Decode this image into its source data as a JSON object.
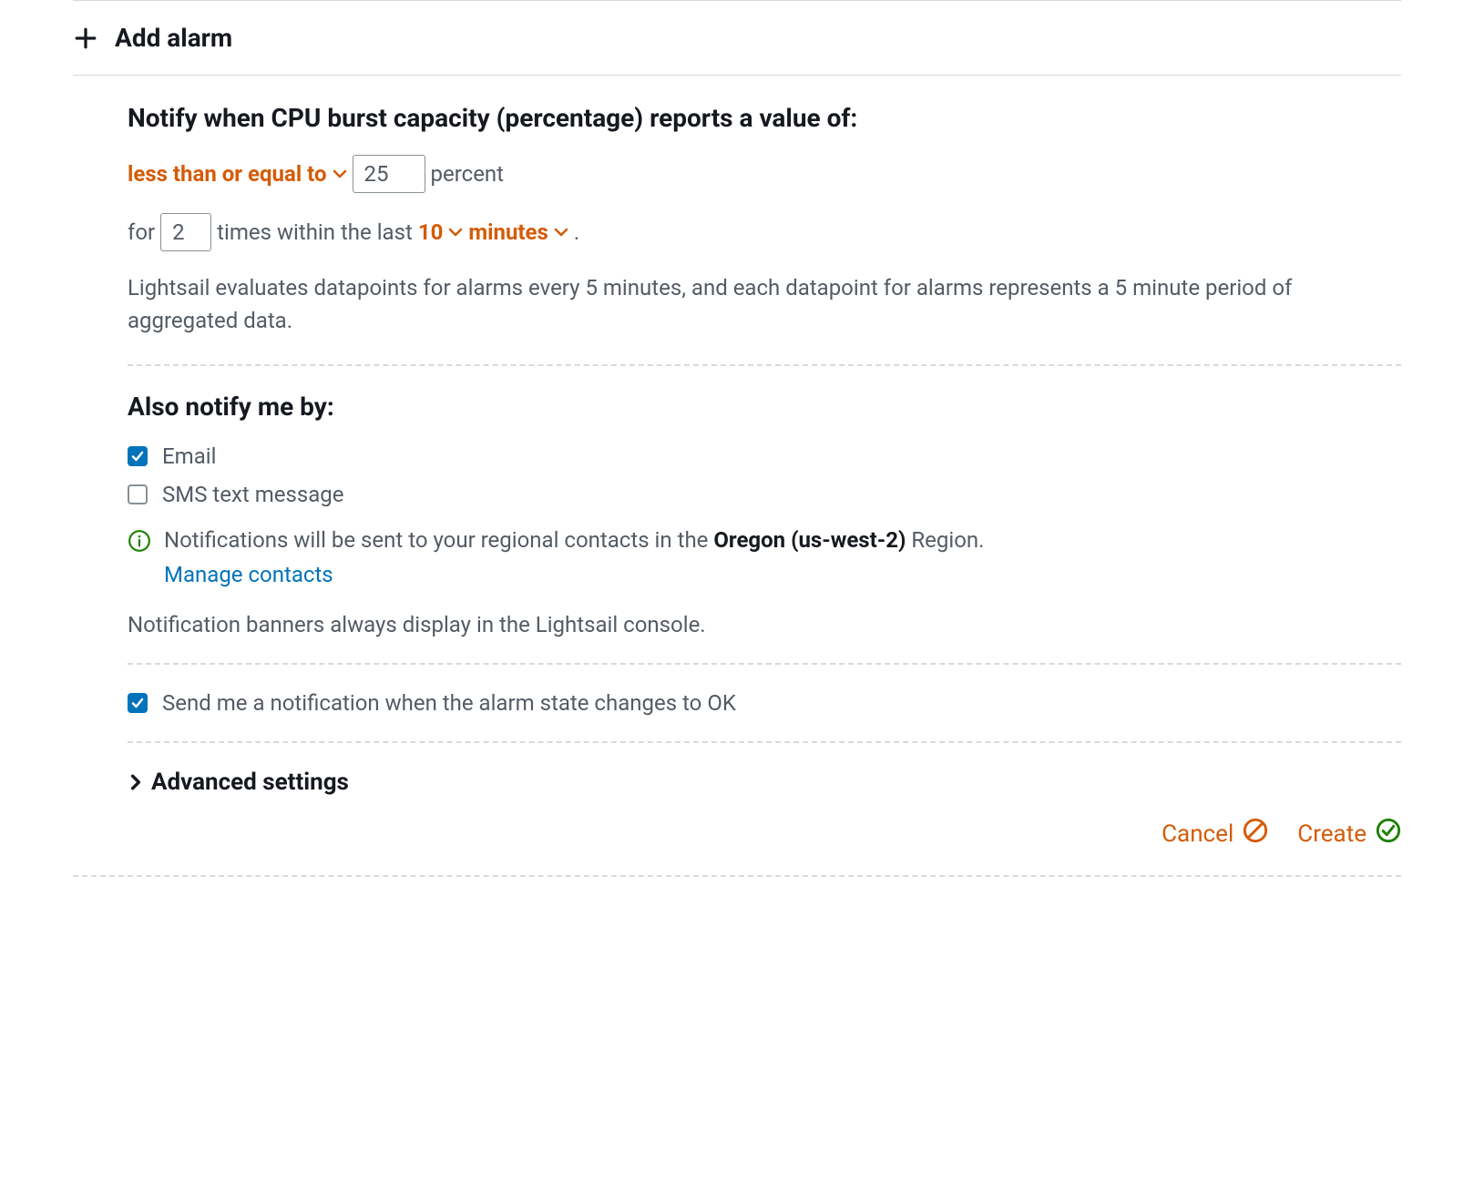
{
  "addAlarm": {
    "label": "Add alarm"
  },
  "mainHeading": "Notify when CPU burst capacity (percentage) reports a value of:",
  "condition": {
    "operator": "less than or equal to",
    "thresholdValue": "25",
    "unitLabel": "percent"
  },
  "duration": {
    "forLabel": "for",
    "timesValue": "2",
    "timesLabel": "times within the last",
    "periodValue": "10",
    "periodUnit": "minutes",
    "periodSuffix": "."
  },
  "evalNote": "Lightsail evaluates datapoints for alarms every 5 minutes, and each datapoint for alarms represents a 5 minute period of aggregated data.",
  "notifyHeading": "Also notify me by:",
  "notifyOptions": {
    "email": {
      "label": "Email",
      "checked": true
    },
    "sms": {
      "label": "SMS text message",
      "checked": false
    }
  },
  "regionNotice": {
    "prefix": "Notifications will be sent to your regional contacts in the ",
    "region": "Oregon (us-west-2)",
    "suffix": " Region.",
    "manageLink": "Manage contacts"
  },
  "bannerNote": "Notification banners always display in the Lightsail console.",
  "okNotify": {
    "label": "Send me a notification when the alarm state changes to OK",
    "checked": true
  },
  "advanced": {
    "label": "Advanced settings"
  },
  "actions": {
    "cancel": "Cancel",
    "create": "Create"
  }
}
